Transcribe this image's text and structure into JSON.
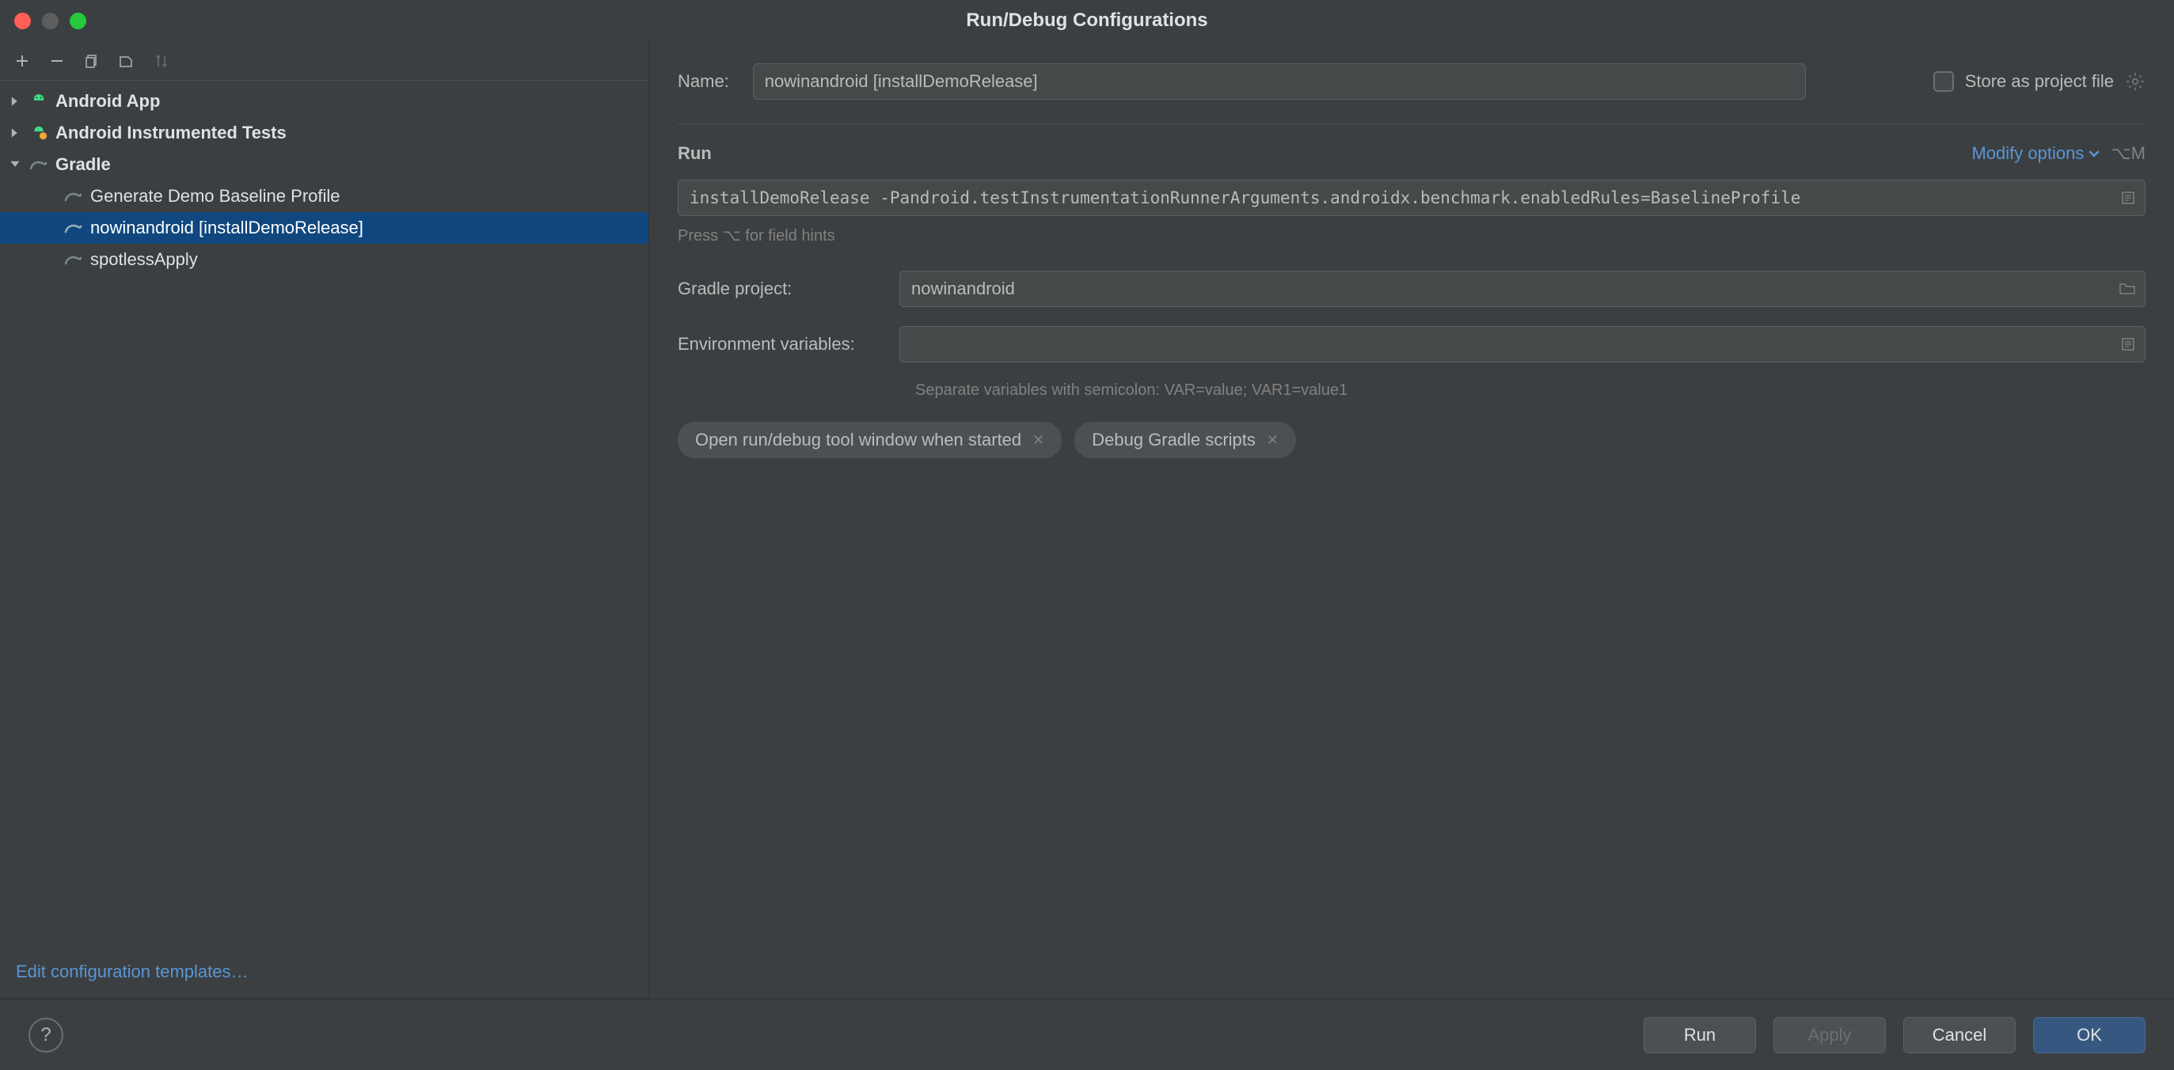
{
  "window": {
    "title": "Run/Debug Configurations"
  },
  "toolbar": {
    "add": "+",
    "remove": "−"
  },
  "tree": {
    "items": [
      {
        "label": "Android App",
        "kind": "group",
        "expanded": false,
        "icon": "android-icon"
      },
      {
        "label": "Android Instrumented Tests",
        "kind": "group",
        "expanded": false,
        "icon": "android-test-icon"
      },
      {
        "label": "Gradle",
        "kind": "group",
        "expanded": true,
        "icon": "gradle-icon"
      }
    ],
    "gradle_children": [
      {
        "label": "Generate Demo Baseline Profile",
        "selected": false
      },
      {
        "label": "nowinandroid [installDemoRelease]",
        "selected": true
      },
      {
        "label": "spotlessApply",
        "selected": false
      }
    ],
    "edit_templates": "Edit configuration templates…"
  },
  "form": {
    "name_label": "Name:",
    "name_value": "nowinandroid [installDemoRelease]",
    "store_label": "Store as project file",
    "run_section": "Run",
    "modify_label": "Modify options",
    "modify_kbd": "⌥M",
    "tasks_value": "installDemoRelease -Pandroid.testInstrumentationRunnerArguments.androidx.benchmark.enabledRules=BaselineProfile",
    "hints": "Press ⌥ for field hints",
    "gradle_project_label": "Gradle project:",
    "gradle_project_value": "nowinandroid",
    "env_label": "Environment variables:",
    "env_value": "",
    "env_hint": "Separate variables with semicolon: VAR=value; VAR1=value1",
    "chips": [
      "Open run/debug tool window when started",
      "Debug Gradle scripts"
    ]
  },
  "footer": {
    "run": "Run",
    "apply": "Apply",
    "cancel": "Cancel",
    "ok": "OK"
  }
}
